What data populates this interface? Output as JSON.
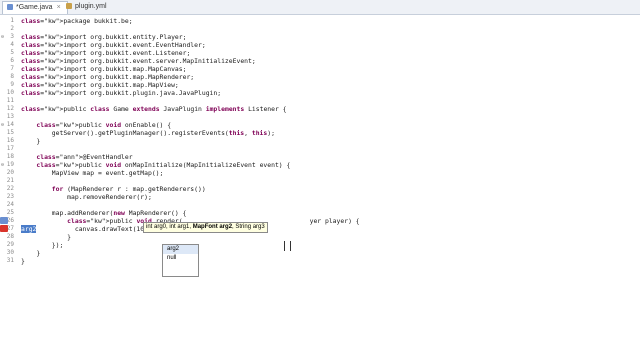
{
  "tabs": [
    {
      "label": "*Game.java",
      "active": true,
      "icon": "java-file-icon"
    },
    {
      "label": "plugin.yml",
      "active": false,
      "icon": "yml-file-icon"
    }
  ],
  "lines": [
    {
      "n": "1",
      "t": "package bukkit.be;"
    },
    {
      "n": "2",
      "t": ""
    },
    {
      "n": "3",
      "t": "import org.bukkit.entity.Player;"
    },
    {
      "n": "4",
      "t": "import org.bukkit.event.EventHandler;"
    },
    {
      "n": "5",
      "t": "import org.bukkit.event.Listener;"
    },
    {
      "n": "6",
      "t": "import org.bukkit.event.server.MapInitializeEvent;"
    },
    {
      "n": "7",
      "t": "import org.bukkit.map.MapCanvas;"
    },
    {
      "n": "8",
      "t": "import org.bukkit.map.MapRenderer;"
    },
    {
      "n": "9",
      "t": "import org.bukkit.map.MapView;"
    },
    {
      "n": "10",
      "t": "import org.bukkit.plugin.java.JavaPlugin;"
    },
    {
      "n": "11",
      "t": ""
    },
    {
      "n": "12",
      "t": "public class Game extends JavaPlugin implements Listener {"
    },
    {
      "n": "13",
      "t": ""
    },
    {
      "n": "14",
      "t": "    public void onEnable() {"
    },
    {
      "n": "15",
      "t": "        getServer().getPluginManager().registerEvents(this, this);"
    },
    {
      "n": "16",
      "t": "    }"
    },
    {
      "n": "17",
      "t": ""
    },
    {
      "n": "18",
      "t": "    @EventHandler"
    },
    {
      "n": "19",
      "t": "    public void onMapInitialize(MapInitializeEvent event) {"
    },
    {
      "n": "20",
      "t": "        MapView map = event.getMap();"
    },
    {
      "n": "21",
      "t": ""
    },
    {
      "n": "22",
      "t": "        for (MapRenderer r : map.getRenderers())"
    },
    {
      "n": "23",
      "t": "            map.removeRenderer(r);"
    },
    {
      "n": "24",
      "t": ""
    },
    {
      "n": "25",
      "t": "        map.addRenderer(new MapRenderer() {"
    },
    {
      "n": "26",
      "t": "            public void render(                                 yer player) {"
    },
    {
      "n": "27",
      "t": "                canvas.drawText(10, 10,       , arg3)"
    },
    {
      "n": "28",
      "t": "            }"
    },
    {
      "n": "29",
      "t": "        });"
    },
    {
      "n": "30",
      "t": "    }"
    },
    {
      "n": "31",
      "t": "}"
    }
  ],
  "tooltip": {
    "pre": "int arg0, int arg1, ",
    "bold": "MapFont arg2",
    "post": ", String arg3"
  },
  "selected_param": "arg2",
  "proposals": [
    "arg2",
    "null"
  ],
  "colors": {
    "keyword": "#7f0055",
    "annotation": "#646464",
    "selection": "#4a7cc9",
    "error": "#d9342b"
  }
}
